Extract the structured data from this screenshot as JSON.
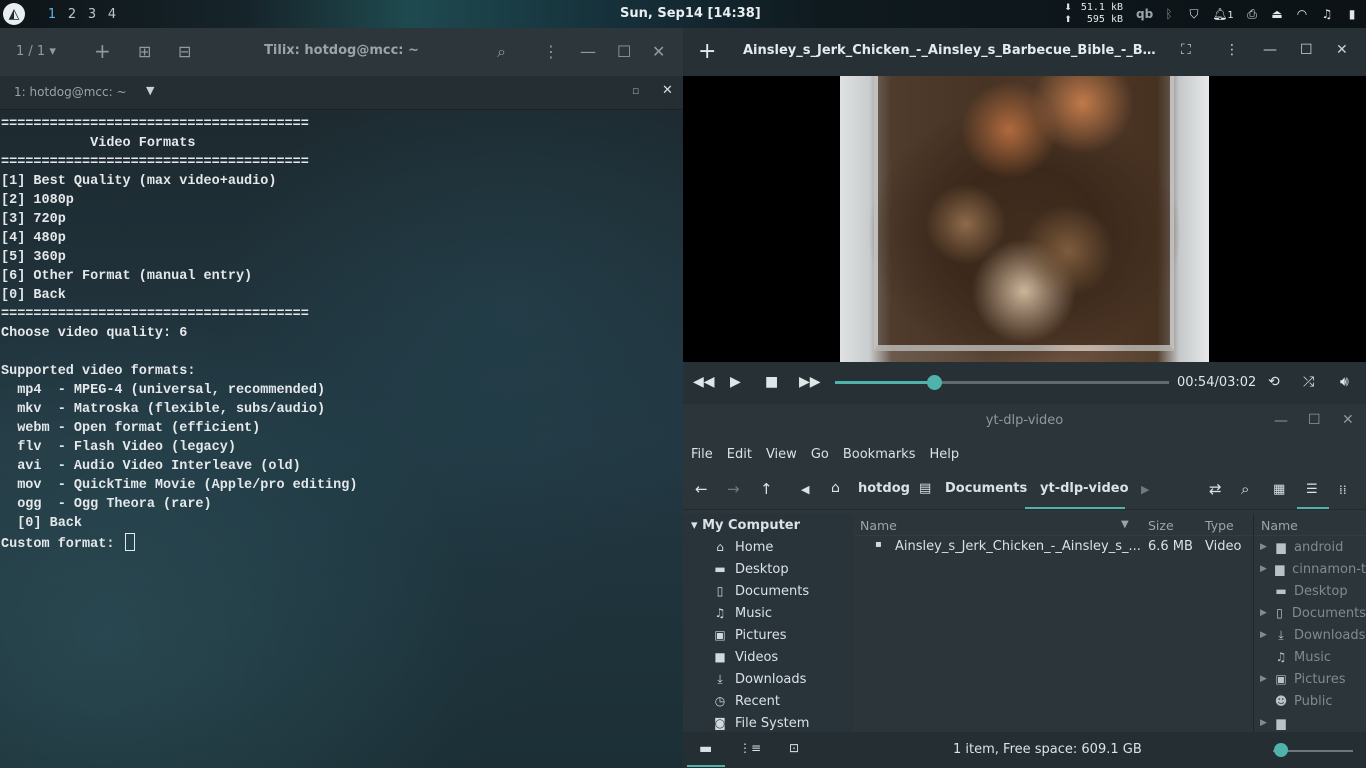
{
  "panel": {
    "workspaces": [
      "1",
      "2",
      "3",
      "4"
    ],
    "clock": "Sun, Sep14 [14:38]",
    "net_down": "51.1 kB",
    "net_up": "595 kB",
    "notification_count": "1"
  },
  "tilix": {
    "tab_counter": "1 / 1",
    "title": "Tilix: hotdog@mcc: ~",
    "session_title": "1: hotdog@mcc: ~",
    "terminal_lines": [
      "======================================",
      "           Video Formats",
      "======================================",
      "[1] Best Quality (max video+audio)",
      "[2] 1080p",
      "[3] 720p",
      "[4] 480p",
      "[5] 360p",
      "[6] Other Format (manual entry)",
      "[0] Back",
      "======================================",
      "Choose video quality: 6",
      "",
      "Supported video formats:",
      "  mp4  - MPEG-4 (universal, recommended)",
      "  mkv  - Matroska (flexible, subs/audio)",
      "  webm - Open format (efficient)",
      "  flv  - Flash Video (legacy)",
      "  avi  - Audio Video Interleave (old)",
      "  mov  - QuickTime Movie (Apple/pro editing)",
      "  ogg  - Ogg Theora (rare)",
      "  [0] Back"
    ],
    "prompt": "Custom format: "
  },
  "player": {
    "title": "Ainsley_s_Jerk_Chicken_-_Ainsley_s_Barbecue_Bible_-_BBC_...",
    "time": "00:54/03:02",
    "progress_fraction": 0.296
  },
  "filemanager": {
    "title": "yt-dlp-video",
    "menu": [
      "File",
      "Edit",
      "View",
      "Go",
      "Bookmarks",
      "Help"
    ],
    "breadcrumbs": [
      "hotdog",
      "Documents",
      "yt-dlp-video"
    ],
    "sidebar_header": "My Computer",
    "sidebar_items": [
      {
        "label": "Home",
        "icon": "home-icon"
      },
      {
        "label": "Desktop",
        "icon": "desktop-icon"
      },
      {
        "label": "Documents",
        "icon": "document-icon"
      },
      {
        "label": "Music",
        "icon": "music-icon"
      },
      {
        "label": "Pictures",
        "icon": "pictures-icon"
      },
      {
        "label": "Videos",
        "icon": "video-icon"
      },
      {
        "label": "Downloads",
        "icon": "download-icon"
      },
      {
        "label": "Recent",
        "icon": "recent-icon"
      },
      {
        "label": "File System",
        "icon": "filesystem-icon"
      }
    ],
    "columns": {
      "name": "Name",
      "size": "Size",
      "type": "Type"
    },
    "files": [
      {
        "name": "Ainsley_s_Jerk_Chicken_-_Ainsley_s_...",
        "size": "6.6 MB",
        "type": "Video"
      }
    ],
    "tree_header": "Name",
    "tree_items": [
      {
        "label": "android",
        "arrow": true,
        "icon": "folder-icon"
      },
      {
        "label": "cinnamon-t",
        "arrow": true,
        "icon": "folder-icon"
      },
      {
        "label": "Desktop",
        "arrow": false,
        "icon": "desktop-icon"
      },
      {
        "label": "Documents",
        "arrow": true,
        "icon": "document-icon"
      },
      {
        "label": "Downloads",
        "arrow": true,
        "icon": "download-icon"
      },
      {
        "label": "Music",
        "arrow": false,
        "icon": "music-icon"
      },
      {
        "label": "Pictures",
        "arrow": true,
        "icon": "pictures-icon"
      },
      {
        "label": "Public",
        "arrow": false,
        "icon": "public-icon"
      },
      {
        "label": "",
        "arrow": true,
        "icon": "folder-icon"
      }
    ],
    "status": "1 item, Free space: 609.1 GB",
    "zoom_fraction": 0.1
  }
}
